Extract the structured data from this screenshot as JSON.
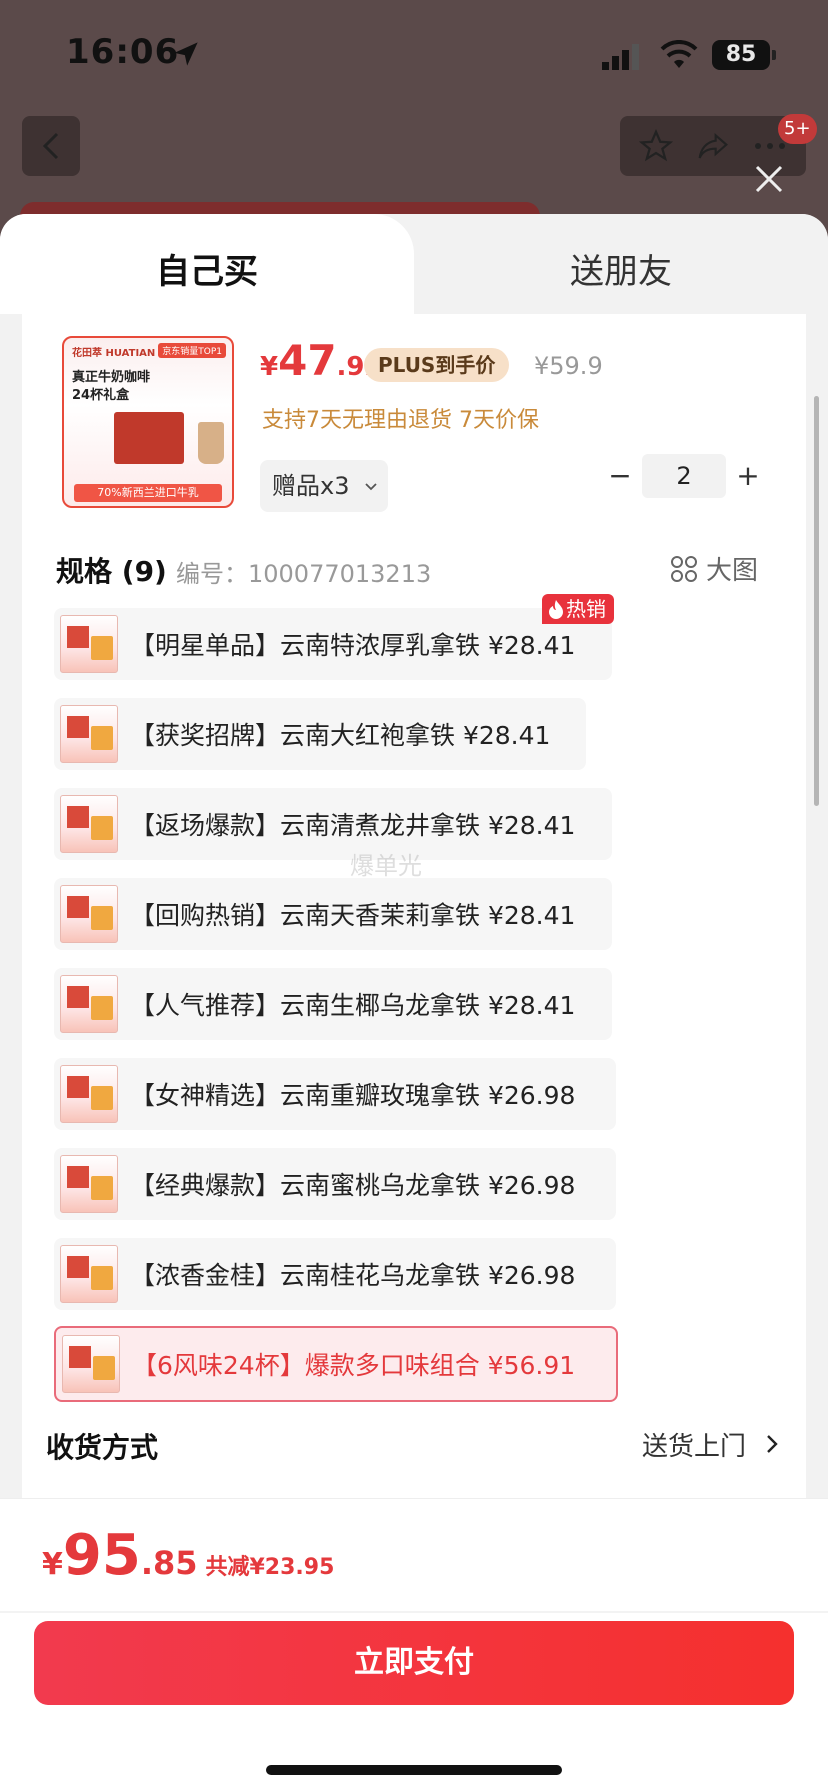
{
  "status_bar": {
    "time": "16:06",
    "battery": "85"
  },
  "header": {
    "badge": "5+"
  },
  "tabs": [
    {
      "label": "自己买",
      "active": true
    },
    {
      "label": "送朋友",
      "active": false
    }
  ],
  "product": {
    "image": {
      "brand": "花田萃 HUATIAN",
      "top_tag": "京东销量TOP1",
      "title_line1": "真正牛奶咖啡",
      "title_line2": "24杯礼盒",
      "bottom_text": "70%新西兰进口牛乳"
    },
    "price_symbol": "¥",
    "price_int": "47",
    "price_dec": ".92",
    "plus_label": "PLUS到手价",
    "original_price": "¥59.9",
    "guarantee": "支持7天无理由退货  7天价保",
    "gift_label": "赠品x3",
    "quantity": "2"
  },
  "spec": {
    "title": "规格",
    "count": "(9)",
    "code": "编号：100077013213",
    "big_image_label": "大图",
    "hot_tag": "热销",
    "items": [
      {
        "label": "【明星单品】云南特浓厚乳拿铁  ¥28.41",
        "selected": false,
        "hot": true
      },
      {
        "label": "【获奖招牌】云南大红袍拿铁  ¥28.41",
        "selected": false,
        "hot": false
      },
      {
        "label": "【返场爆款】云南清煮龙井拿铁  ¥28.41",
        "selected": false,
        "hot": false
      },
      {
        "label": "【回购热销】云南天香茉莉拿铁  ¥28.41",
        "selected": false,
        "hot": false
      },
      {
        "label": "【人气推荐】云南生椰乌龙拿铁  ¥28.41",
        "selected": false,
        "hot": false
      },
      {
        "label": "【女神精选】云南重瓣玫瑰拿铁  ¥26.98",
        "selected": false,
        "hot": false
      },
      {
        "label": "【经典爆款】云南蜜桃乌龙拿铁  ¥26.98",
        "selected": false,
        "hot": false
      },
      {
        "label": "【浓香金桂】云南桂花乌龙拿铁  ¥26.98",
        "selected": false,
        "hot": false
      },
      {
        "label": "【6风味24杯】爆款多口味组合  ¥56.91",
        "selected": true,
        "hot": false
      }
    ]
  },
  "delivery": {
    "label": "收货方式",
    "value": "送货上门"
  },
  "footer": {
    "total_symbol": "¥",
    "total_int": "95",
    "total_dec": ".85",
    "saving": "共减¥23.95",
    "pay_label": "立即支付"
  },
  "watermark": "爆单光",
  "colors": {
    "accent": "#e4393c",
    "plus_bg": "#f7e0c8",
    "guarantee": "#c98a3a"
  }
}
